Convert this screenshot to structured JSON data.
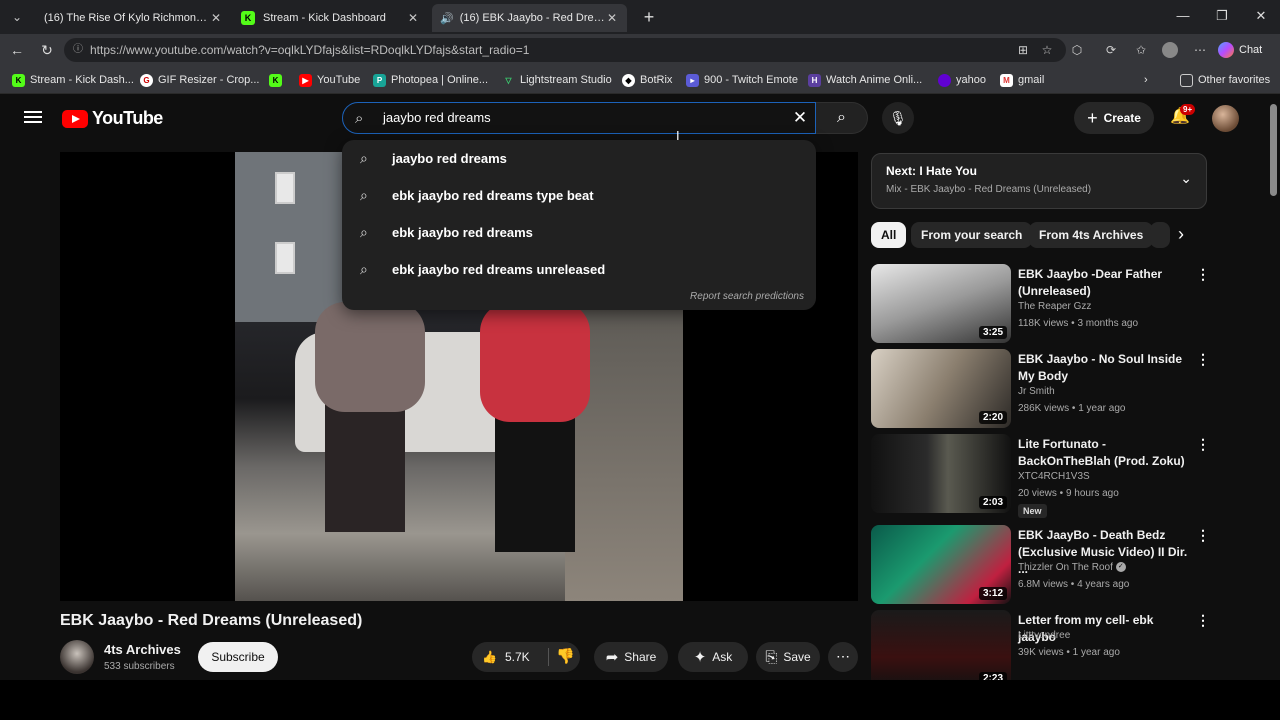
{
  "tabs": [
    {
      "title": "(16) The Rise Of Kylo Richmond...",
      "favicon": "youtube-icon"
    },
    {
      "title": "Stream - Kick Dashboard",
      "favicon": "kick-icon"
    },
    {
      "title": "(16) EBK Jaaybo - Red Dreams",
      "favicon": "youtube-icon",
      "audio": true
    }
  ],
  "address": {
    "url": "https://www.youtube.com/watch?v=oqlkLYDfajs&list=RDoqlkLYDfajs&start_radio=1"
  },
  "chat_label": "Chat",
  "bookmarks": [
    "Stream - Kick Dash...",
    "GIF Resizer - Crop...",
    "",
    "YouTube",
    "Photopea | Online...",
    "Lightstream Studio",
    "BotRix",
    "900 - Twitch Emote",
    "Watch Anime Onli...",
    "yahoo",
    "gmail"
  ],
  "other_favorites": "Other favorites",
  "youtube": {
    "logo_text": "YouTube",
    "search_value": "jaaybo red dreams",
    "suggestions": [
      "jaaybo red dreams",
      "ebk jaaybo red dreams type beat",
      "ebk jaaybo red dreams",
      "ebk jaaybo red dreams unreleased"
    ],
    "report_label": "Report search predictions",
    "create_label": "Create",
    "notif_badge": "9+"
  },
  "video": {
    "title": "EBK Jaaybo - Red Dreams (Unreleased)",
    "channel": "4ts Archives",
    "subscribers": "533 subscribers",
    "subscribe_label": "Subscribe",
    "likes": "5.7K",
    "share_label": "Share",
    "ask_label": "Ask",
    "save_label": "Save"
  },
  "next": {
    "title": "Next: I Hate You",
    "subtitle": "Mix - EBK Jaaybo - Red Dreams (Unreleased)"
  },
  "chips": [
    "All",
    "From your search",
    "From 4ts Archives"
  ],
  "related": [
    {
      "title": "EBK Jaaybo -Dear Father (Unreleased)",
      "channel": "The Reaper Gzz",
      "meta": "118K views • 3 months ago",
      "duration": "3:25"
    },
    {
      "title": "EBK Jaaybo - No Soul Inside My Body",
      "channel": "Jr Smith",
      "meta": "286K views • 1 year ago",
      "duration": "2:20"
    },
    {
      "title": "Lite Fortunato - BackOnTheBlah (Prod. Zoku)",
      "channel": "XTC4RCH1V3S",
      "meta": "20 views • 9 hours ago",
      "duration": "2:03",
      "badge": "New"
    },
    {
      "title": "EBK JaayBo - Death Bedz (Exclusive Music Video) II Dir. ...",
      "channel": "Thizzler On The Roof",
      "meta": "6.8M views • 4 years ago",
      "duration": "3:12"
    },
    {
      "title": "Letter from my cell- ebk jaaybo",
      "channel": "Litttvondree",
      "meta": "39K views • 1 year ago",
      "duration": "2:23"
    }
  ]
}
